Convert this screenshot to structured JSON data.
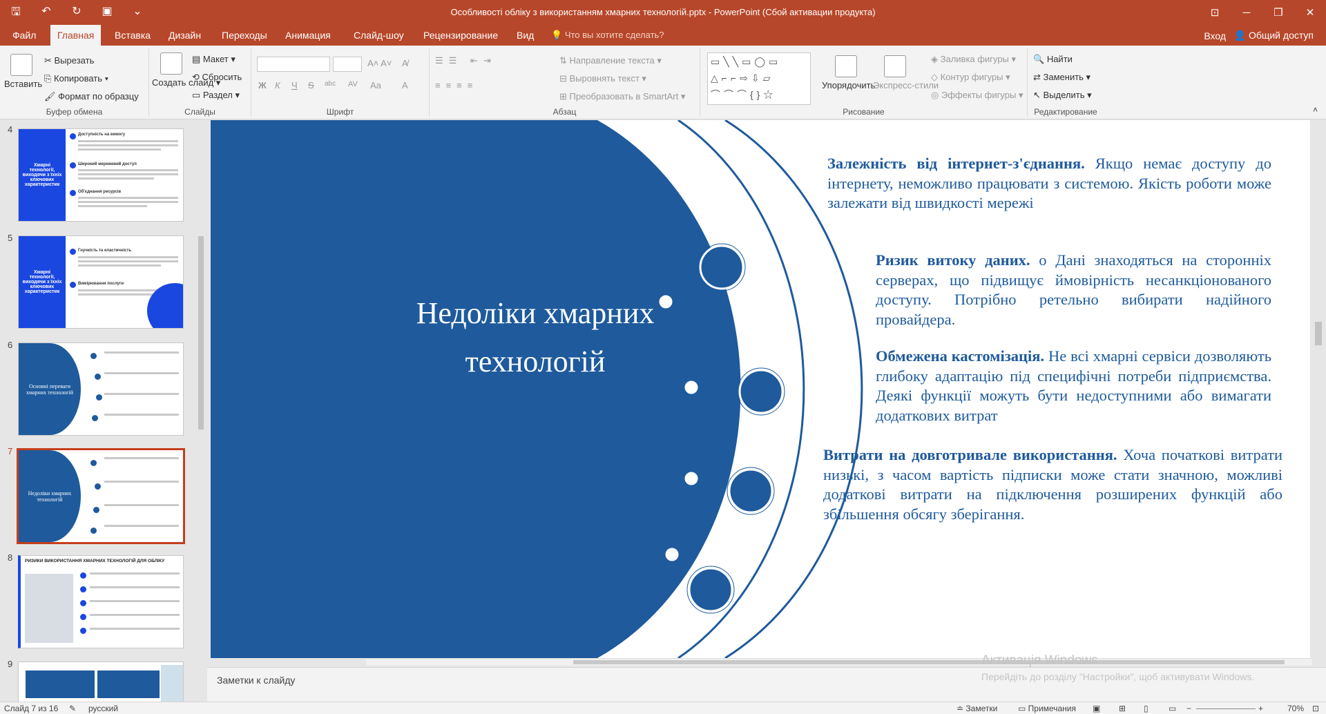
{
  "window": {
    "title": "Особливості обліку з використанням хмарних технологій.pptx - PowerPoint (Сбой активации продукта)"
  },
  "tabs": [
    "Файл",
    "Главная",
    "Вставка",
    "Дизайн",
    "Переходы",
    "Анимация",
    "Слайд-шоу",
    "Рецензирование",
    "Вид"
  ],
  "tellme": "Что вы хотите сделать?",
  "signin": "Вход",
  "share": "Общий доступ",
  "ribbon": {
    "clipboard": {
      "label": "Буфер обмена",
      "paste": "Вставить",
      "cut": "Вырезать",
      "copy": "Копировать",
      "format": "Формат по образцу"
    },
    "slides": {
      "label": "Слайды",
      "new": "Создать слайд",
      "layout": "Макет",
      "reset": "Сбросить",
      "section": "Раздел"
    },
    "font": {
      "label": "Шрифт",
      "bold": "Ж",
      "italic": "К",
      "underline": "Ч",
      "strike": "S",
      "shadow": "abc",
      "spacing": "AV",
      "case": "Aa",
      "color": "A"
    },
    "paragraph": {
      "label": "Абзац",
      "direction": "Направление текста",
      "align": "Выровнять текст",
      "smartart": "Преобразовать в SmartArt"
    },
    "drawing": {
      "label": "Рисование",
      "arrange": "Упорядочить",
      "styles": "Экспресс-стили",
      "fill": "Заливка фигуры",
      "outline": "Контур фигуры",
      "effects": "Эффекты фигуры"
    },
    "editing": {
      "label": "Редактирование",
      "find": "Найти",
      "replace": "Заменить",
      "select": "Выделить"
    }
  },
  "thumbs": [
    {
      "num": "4",
      "title": "Хмарні технології, виходячи з їхніх ключових характеристик",
      "items": [
        "Доступність на вимогу",
        "Широкий мережевий доступ",
        "Об'єднання ресурсів"
      ]
    },
    {
      "num": "5",
      "title": "Хмарні технології, виходячи з їхніх ключових характеристик",
      "items": [
        "Гнучкість та еластичність",
        "Вимірювання послуги"
      ]
    },
    {
      "num": "6",
      "title": "Основні переваги хмарних технологій"
    },
    {
      "num": "7",
      "title": "Недоліки хмарних технологій"
    },
    {
      "num": "8",
      "title": "РИЗИКИ ВИКОРИСТАННЯ ХМАРНИХ ТЕХНОЛОГІЙ ДЛЯ ОБЛІКУ"
    },
    {
      "num": "9"
    }
  ],
  "slide": {
    "title": "Недоліки хмарних технологій",
    "items": [
      {
        "head": "Залежність від інтернет-з'єднання.",
        "body": " Якщо немає доступу до інтернету, неможливо працювати з системою. Якість роботи може залежати від швидкості мережі"
      },
      {
        "head": "Ризик витоку даних.",
        "body": " o Дані знаходяться на сторонніх серверах, що підвищує ймовірність несанкціонованого доступу. Потрібно ретельно вибирати надійного провайдера."
      },
      {
        "head": "Обмежена кастомізація.",
        "body": " Не всі хмарні сервіси дозволяють глибоку адаптацію під специфічні потреби підприємства. Деякі функції можуть бути недоступними або вимагати додаткових витрат"
      },
      {
        "head": "Витрати на довготривале використання.",
        "body": " Хоча початкові витрати низькі, з часом вартість підписки може стати значною, можливі додаткові витрати на підключення розширених функцій або збільшення обсягу зберігання."
      }
    ]
  },
  "notes": "Заметки к слайду",
  "activation": {
    "line1": "Активація Windows",
    "line2": "Перейдіть до розділу \"Настройки\", щоб активувати Windows."
  },
  "status": {
    "slide": "Слайд 7 из 16",
    "lang": "русский",
    "notes": "Заметки",
    "comments": "Примечания",
    "zoom": "70%"
  },
  "colors": {
    "accent": "#b7472a",
    "slide_blue": "#1e5a9c"
  }
}
